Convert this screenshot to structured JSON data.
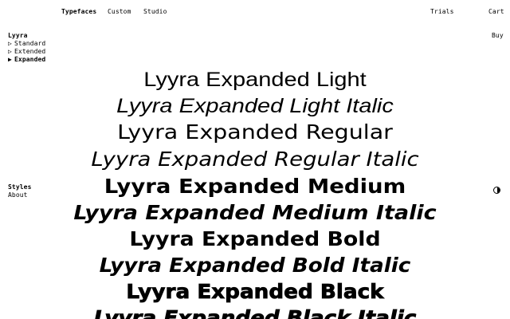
{
  "nav": {
    "typefaces": "Typefaces",
    "custom": "Custom",
    "studio": "Studio",
    "trials": "Trials",
    "cart": "Cart"
  },
  "sidebar": {
    "family": "Lyyra",
    "widths": [
      {
        "label": "Standard",
        "marker": "▷",
        "active": false
      },
      {
        "label": "Extended",
        "marker": "▷",
        "active": false
      },
      {
        "label": "Expanded",
        "marker": "▶",
        "active": true
      }
    ],
    "buy": "Buy",
    "sections": {
      "styles": "Styles",
      "about": "About"
    }
  },
  "theme_toggle": {
    "icon": "half-circle-contrast-icon"
  },
  "specimens": [
    "Lyyra Expanded Light",
    "Lyyra Expanded Light Italic",
    "Lyyra Expanded Regular",
    "Lyyra Expanded Regular Italic",
    "Lyyra Expanded Medium",
    "Lyyra Expanded Medium Italic",
    "Lyyra Expanded Bold",
    "Lyyra Expanded Bold Italic",
    "Lyyra Expanded Black",
    "Lyyra Expanded Black Italic"
  ]
}
